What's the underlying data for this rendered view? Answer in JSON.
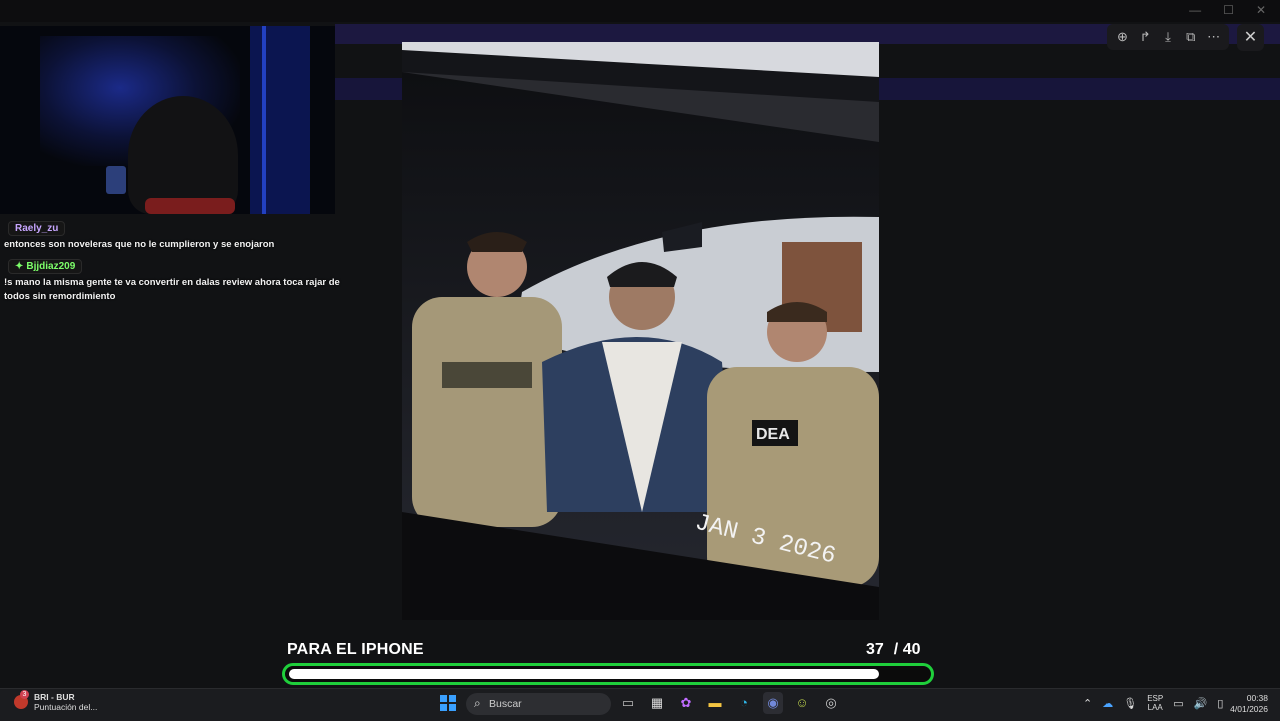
{
  "viewer": {
    "tools": [
      "zoom-in-icon",
      "share-icon",
      "download-icon",
      "open-external-icon",
      "more-icon"
    ],
    "close_label": "✕"
  },
  "chat": {
    "messages": [
      {
        "user": "Raely_zu",
        "text": "entonces son noveleras que no le cumplieron y se enojaron"
      },
      {
        "user": "Bjjdiaz209",
        "text": "!s mano la misma gente te va convertir en dalas review ahora toca rajar de todos sin remordimiento"
      }
    ]
  },
  "photo": {
    "stamp": "JAN 3 2026",
    "vest_patch": "DEA"
  },
  "quiz": {
    "label": "PARA EL IPHONE",
    "current": "37",
    "total": "/ 40",
    "progress_fraction": 0.925,
    "accent": "#1fcf3b"
  },
  "taskbar": {
    "widget_badge": "3",
    "widget_title": "BRI - BUR",
    "widget_sub": "Puntuación del...",
    "search_placeholder": "Buscar",
    "lang_1": "ESP",
    "lang_2": "LAA",
    "time": "00:38",
    "date": "4/01/2026"
  }
}
